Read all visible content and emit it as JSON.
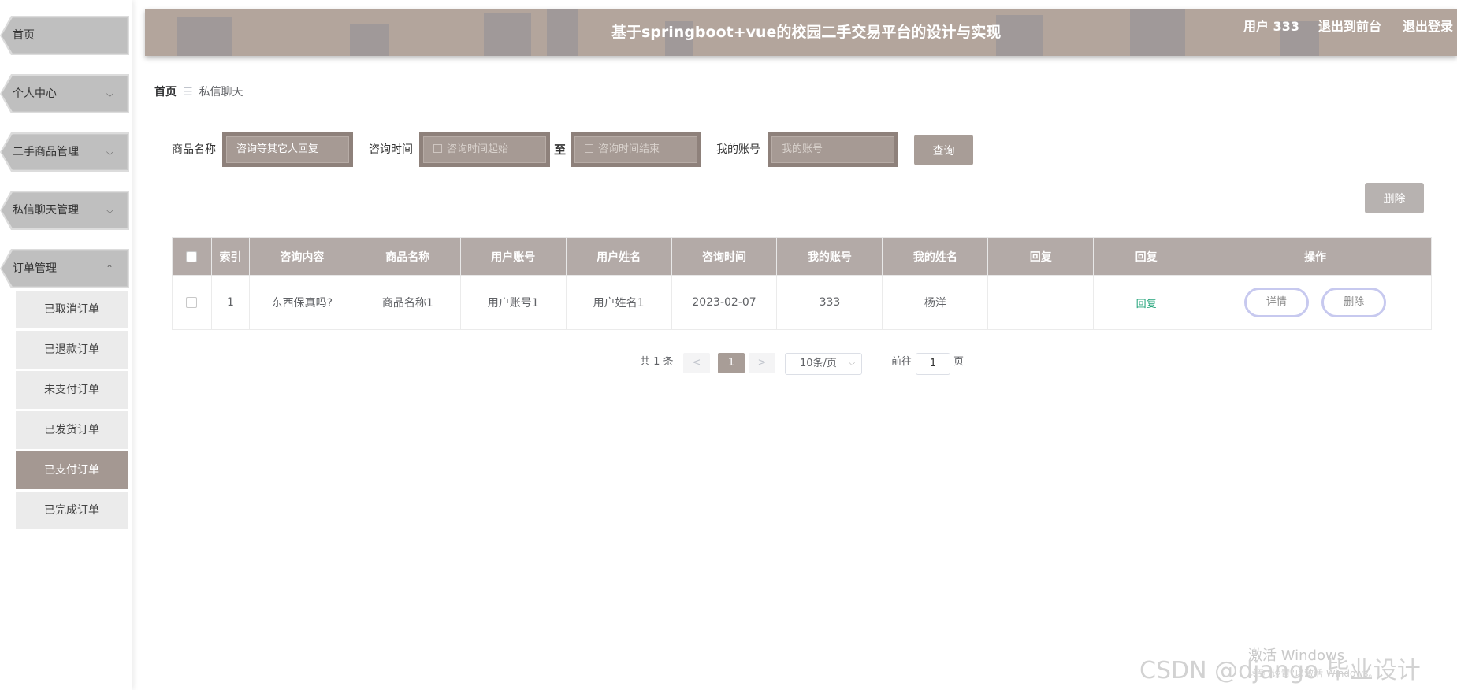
{
  "header": {
    "title": "基于springboot+vue的校园二手交易平台的设计与实现",
    "user": "用户 333",
    "to_front": "退出到前台",
    "logout": "退出登录"
  },
  "sidebar": {
    "menus": [
      {
        "label": "首页"
      },
      {
        "label": "个人中心"
      },
      {
        "label": "二手商品管理"
      },
      {
        "label": "私信聊天管理"
      },
      {
        "label": "订单管理"
      }
    ],
    "submenus": [
      {
        "label": "已取消订单"
      },
      {
        "label": "已退款订单"
      },
      {
        "label": "未支付订单"
      },
      {
        "label": "已发货订单"
      },
      {
        "label": "已支付订单"
      },
      {
        "label": "已完成订单"
      }
    ]
  },
  "breadcrumb": {
    "home": "首页",
    "separator": "☰",
    "current": "私信聊天"
  },
  "search": {
    "product_label": "商品名称",
    "product_value": "咨询等其它人回复",
    "time_label": "咨询时间",
    "time_start_placeholder": "咨询时间起始",
    "to": "至",
    "time_end_placeholder": "咨询时间结束",
    "account_label": "我的账号",
    "account_placeholder": "我的账号",
    "query_button": "查询"
  },
  "actions": {
    "delete_button": "删除"
  },
  "table": {
    "headers": [
      "索引",
      "咨询内容",
      "商品名称",
      "用户账号",
      "用户姓名",
      "咨询时间",
      "我的账号",
      "我的姓名",
      "回复",
      "回复",
      "操作"
    ],
    "rows": [
      {
        "index": "1",
        "content": "东西保真吗?",
        "product": "商品名称1",
        "account": "用户账号1",
        "name": "用户姓名1",
        "time": "2023-02-07",
        "my_account": "333",
        "my_name": "杨洋",
        "reply": "",
        "reply_link": "回复",
        "detail": "详情",
        "delete": "删除"
      }
    ]
  },
  "pagination": {
    "total": "共 1 条",
    "prev": "<",
    "page": "1",
    "next": ">",
    "page_size": "10条/页",
    "goto": "前往",
    "goto_value": "1",
    "page_unit": "页"
  },
  "watermark": {
    "windows_title": "激活 Windows",
    "windows_sub": "转到\"设置\"以激活 Windows。",
    "csdn": "CSDN @django 毕业设计"
  },
  "colors": {
    "accent": "#a89d97",
    "header_bg": "#b3a59c",
    "active_menu": "#a49892",
    "reply_link": "#23a47a"
  }
}
